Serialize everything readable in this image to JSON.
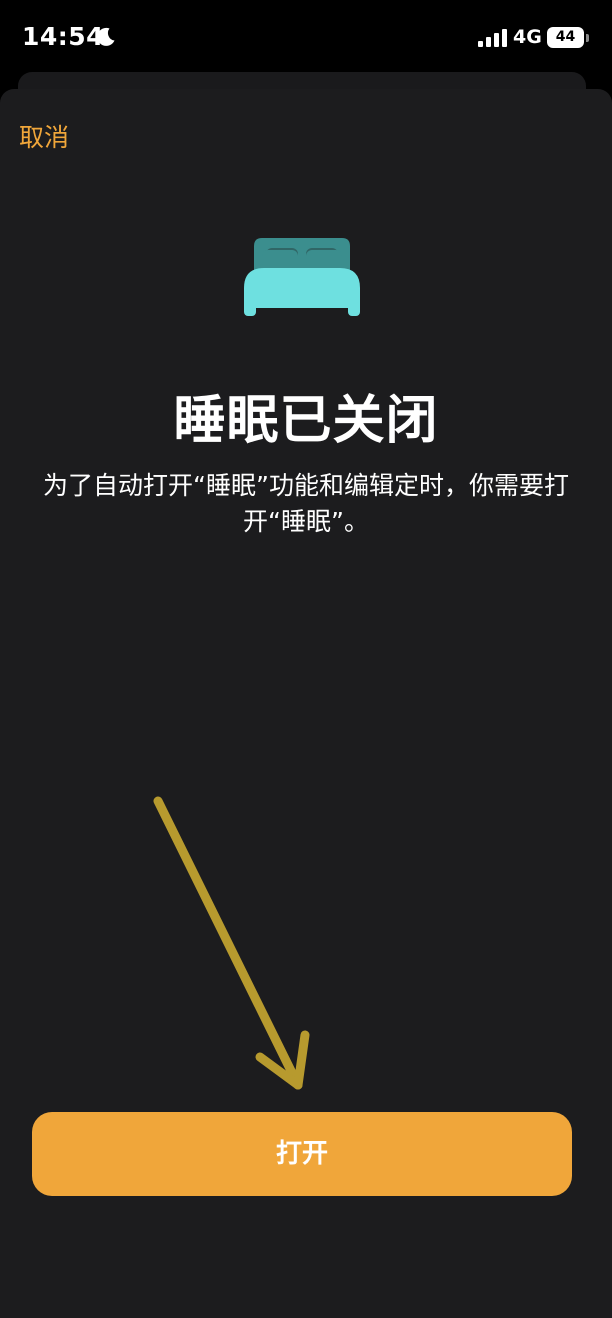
{
  "status_bar": {
    "time": "14:54",
    "network": "4G",
    "battery": "44"
  },
  "sheet": {
    "cancel_label": "取消",
    "title": "睡眠已关闭",
    "description": "为了自动打开“睡眠”功能和编辑定时，你需要打开“睡眠”。",
    "primary_button_label": "打开"
  },
  "icons": {
    "status": [
      "moon-icon",
      "signal-icon"
    ],
    "hero": "bed-icon",
    "annotation": "arrow-icon"
  },
  "colors": {
    "accent": "#f0a63a",
    "bed_light": "#6ee0e0",
    "bed_dark": "#3b8e8e",
    "sheet_bg": "#1c1c1e",
    "arrow": "#b79a2e"
  }
}
